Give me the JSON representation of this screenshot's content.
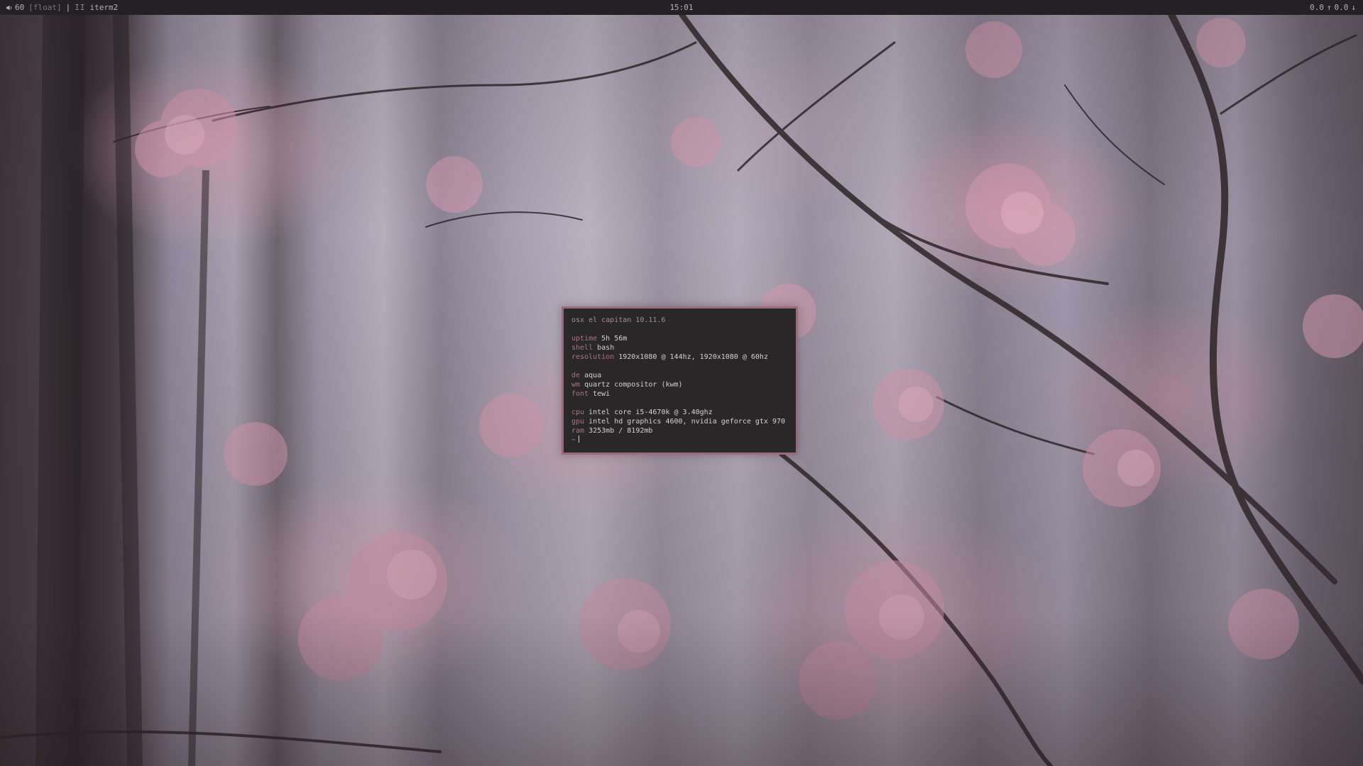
{
  "topbar": {
    "volume_level": "60",
    "layout_mode": "[float]",
    "separator": "|",
    "bars": "II",
    "active_app": "iterm2",
    "clock": "15:01",
    "net_up": "0.0",
    "net_down": "0.0"
  },
  "terminal": {
    "os_line": "osx el capitan 10.11.6",
    "groups": [
      [
        {
          "key": "uptime",
          "value": "5h 56m"
        },
        {
          "key": "shell",
          "value": "bash"
        },
        {
          "key": "resolution",
          "value": "1920x1080 @ 144hz, 1920x1080 @ 60hz"
        }
      ],
      [
        {
          "key": "de",
          "value": "aqua"
        },
        {
          "key": "wm",
          "value": "quartz compositor (kwm)"
        },
        {
          "key": "font",
          "value": "tewi"
        }
      ],
      [
        {
          "key": "cpu",
          "value": "intel core i5-4670k @ 3.40ghz"
        },
        {
          "key": "gpu",
          "value": "intel hd graphics 4600, nvidia geforce gtx 970"
        },
        {
          "key": "ram",
          "value": "3253mb / 8192mb"
        }
      ]
    ],
    "prompt": "~"
  },
  "colors": {
    "bar_bg": "#232123",
    "terminal_bg": "#2a2729",
    "terminal_border": "#9a6a7a",
    "key_color": "#b07285"
  },
  "icons": {
    "volume": "speaker-icon",
    "upload": "arrow-up-icon",
    "download": "arrow-down-icon"
  }
}
